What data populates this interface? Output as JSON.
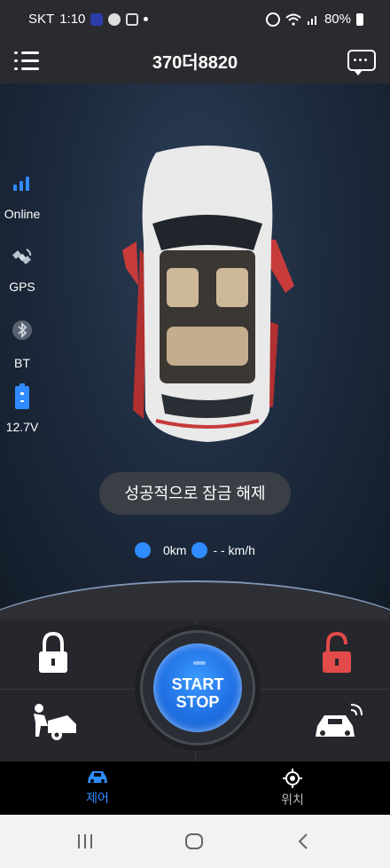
{
  "status": {
    "carrier": "SKT",
    "time": "1:10",
    "battery": "80%"
  },
  "header": {
    "title": "370더8820"
  },
  "side": {
    "online": "Online",
    "gps": "GPS",
    "bt": "BT",
    "voltage": "12.7V"
  },
  "toast": "성공적으로 잠금 해제",
  "speed": {
    "odometer": "0km",
    "speed": "- - km/h"
  },
  "controls": {
    "start": "START",
    "stop": "STOP"
  },
  "tabs": {
    "control": "제어",
    "location": "위치"
  },
  "colors": {
    "accent": "#2f8bff",
    "unlock": "#e34a4a"
  }
}
